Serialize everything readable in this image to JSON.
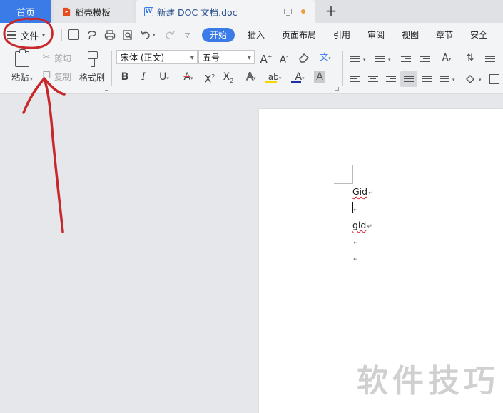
{
  "tabs": {
    "home": "首页",
    "template": "稻壳模板",
    "document": "新建 DOC 文档.doc",
    "new_tab": "+"
  },
  "menu": {
    "file": "文件",
    "tabs": [
      "开始",
      "插入",
      "页面布局",
      "引用",
      "审阅",
      "视图",
      "章节",
      "安全"
    ],
    "active_tab": "开始"
  },
  "toolbar": {
    "paste": "粘贴",
    "cut": "剪切",
    "copy": "复制",
    "format_painter": "格式刷",
    "font_family": "宋体 (正文)",
    "font_size": "五号",
    "pinyin": "文",
    "bold": "B",
    "italic": "I",
    "underline": "U",
    "strikethrough": "A",
    "superscript": "X",
    "subscript": "X",
    "text_effect": "A",
    "highlight": "ab",
    "font_color": "A",
    "char_shading": "A",
    "grow_font": "A",
    "shrink_font": "A"
  },
  "colors": {
    "accent": "#3a7be8",
    "highlight_bar": "#f5d800",
    "font_color_bar": "#1f2f9e",
    "strike_bar": "#e23b3b",
    "annotation": "#c8282b",
    "unsaved_dot": "#f19a3e"
  },
  "document": {
    "lines": [
      "Gid",
      "",
      "gid",
      "",
      ""
    ],
    "watermark": "软件技巧"
  },
  "icons": [
    "hamburger-icon",
    "save-icon",
    "lasso-icon",
    "print-icon",
    "print-preview-icon",
    "undo-icon",
    "redo-icon",
    "more-icon",
    "clipboard-icon",
    "scissors-icon",
    "copy-icon",
    "format-brush-icon",
    "eraser-icon",
    "document-handle-icon"
  ]
}
